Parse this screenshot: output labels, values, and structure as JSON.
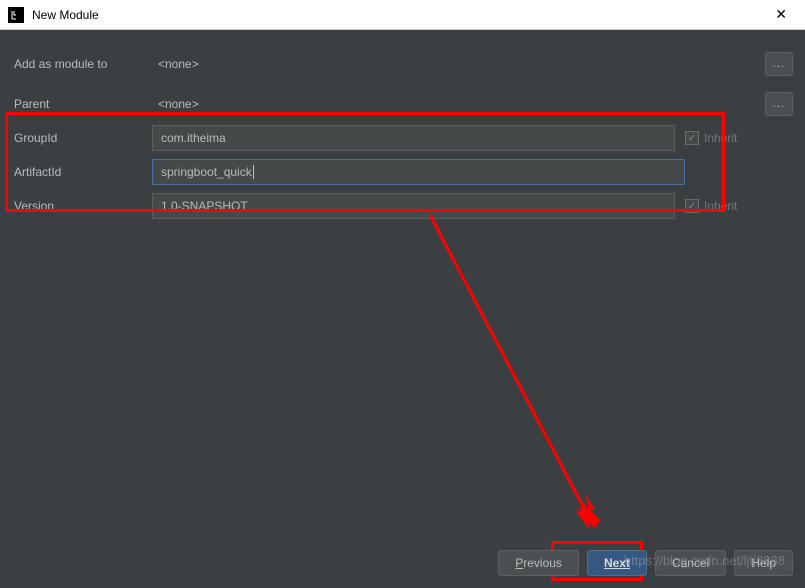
{
  "titlebar": {
    "title": "New Module",
    "close": "✕"
  },
  "labels": {
    "addAsModuleTo": "Add as module to",
    "parent": "Parent",
    "groupId": "GroupId",
    "artifactId": "ArtifactId",
    "version": "Version",
    "inherit": "Inherit",
    "none": "<none>"
  },
  "values": {
    "groupId": "com.itheima",
    "artifactId": "springboot_quick",
    "version": "1.0-SNAPSHOT"
  },
  "buttons": {
    "previous": "Previous",
    "next": "Next",
    "cancel": "Cancel",
    "help": "Help",
    "dots": "..."
  },
  "watermark": "https://blog.csdn.net/ljtj8888"
}
